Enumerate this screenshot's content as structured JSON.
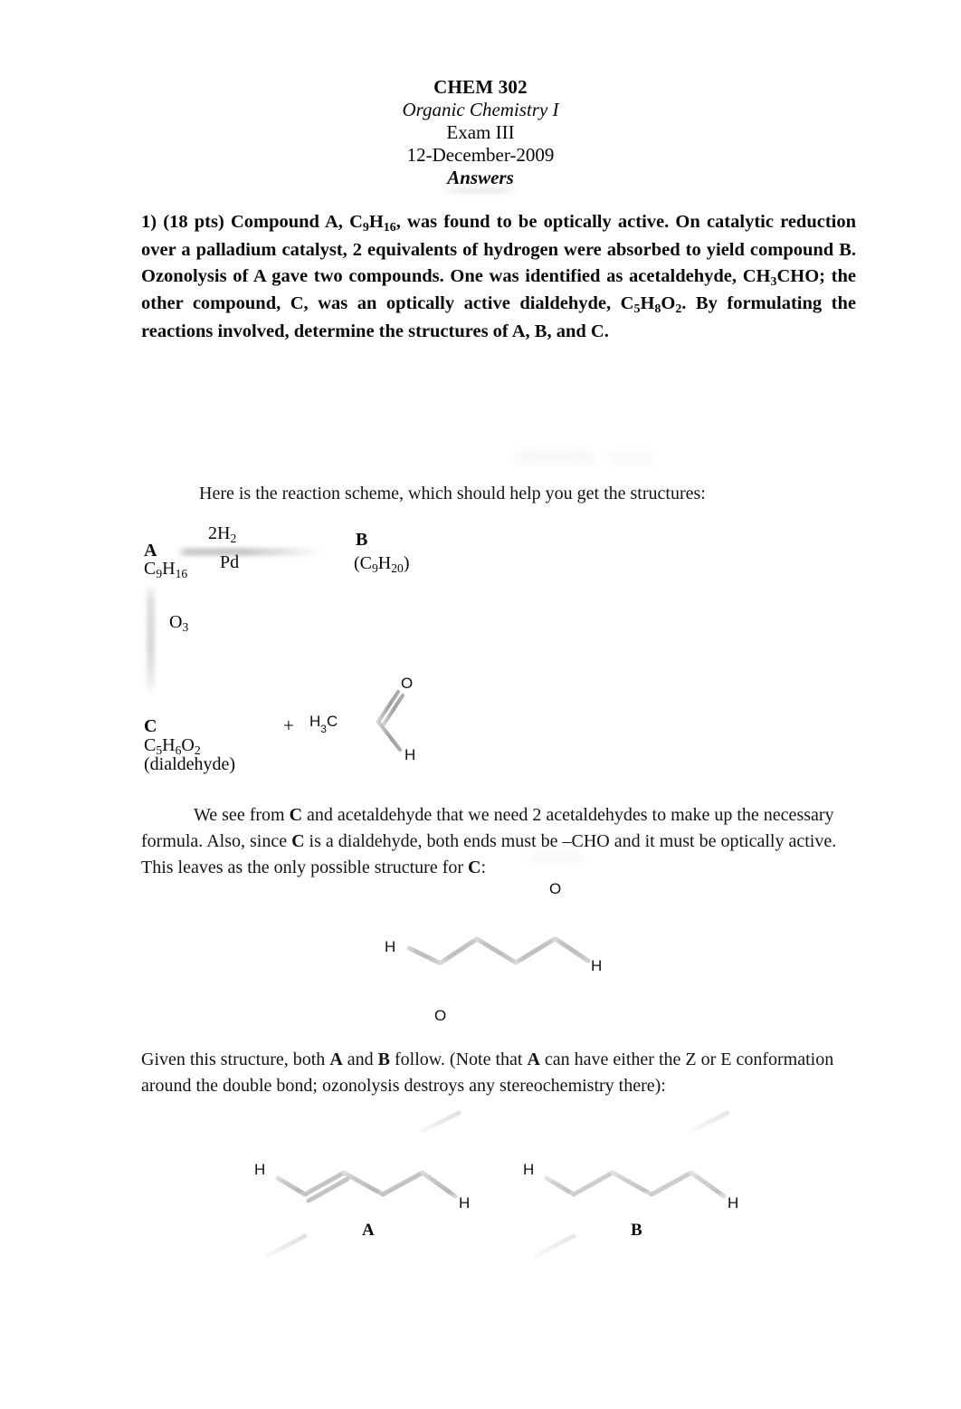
{
  "document": {
    "header": {
      "course": "CHEM 302",
      "subtitle": "Organic Chemistry I",
      "exam": "Exam III",
      "date": "12-December-2009",
      "answers": "Answers"
    },
    "problem": {
      "number": "1)",
      "points": "(18 pts)",
      "text_part_1": "1) (18 pts) Compound A, C",
      "full_text": "1) (18 pts) Compound A, C9H16, was found to be optically active. On catalytic reduction over a palladium catalyst, 2 equivalents of hydrogen were absorbed to yield compound B. Ozonolysis of A gave two compounds. One was identified as acetaldehyde, CH3CHO; the other compound, C, was an optically active dialdehyde, C5H8O2. By formulating the reactions involved, determine the structures of A, B, and C."
    },
    "intro_line": "Here is the reaction scheme, which should help you get the structures:",
    "scheme": {
      "compound_a_label": "A",
      "compound_a_formula_c": "C",
      "compound_a_formula_sub1": "9",
      "compound_a_formula_h": "H",
      "compound_a_formula_sub2": "16",
      "reagent_top": "2H",
      "reagent_top_sub": "2",
      "reagent_bottom": "Pd",
      "compound_b_label": "B",
      "compound_b_formula": "(C",
      "compound_b_sub1": "9",
      "compound_b_h": "H",
      "compound_b_sub2": "20",
      "compound_b_close": ")",
      "ozone_reagent": "O",
      "ozone_sub": "3",
      "compound_c_label": "C",
      "compound_c_formula_c": "C",
      "compound_c_sub1": "5",
      "compound_c_h": "H",
      "compound_c_sub2": "6",
      "compound_c_o": "O",
      "compound_c_sub3": "2",
      "compound_c_note": "(dialdehyde)",
      "plus_sign": "+",
      "acetaldehyde_methyl": "H",
      "acetaldehyde_methyl_sub": "3",
      "acetaldehyde_methyl_c": "C",
      "acetaldehyde_o": "O",
      "acetaldehyde_h": "H"
    },
    "paragraph_c": {
      "line1_a": "We see from ",
      "line1_b": "C",
      "line1_c": " and acetaldehyde that we need 2 acetaldehydes to make up the necessary formula. Also, since ",
      "line1_d": "C",
      "line1_e": " is a dialdehyde, both ends must be –CHO and it must be optically active. This leaves as the only possible structure for ",
      "line1_f": "C",
      "line1_g": ":"
    },
    "structure_c": {
      "label_h_left": "H",
      "label_o_bottom": "O",
      "label_o_top": "O",
      "label_h_right": "H"
    },
    "paragraph_ab": {
      "part1": "Given this structure, both ",
      "bold_a": "A",
      "part2": " and ",
      "bold_b": "B",
      "part3": " follow. (Note that ",
      "bold_a2": "A",
      "part4": " can have either the Z or E conformation around the double bond; ozonolysis destroys any stereochemistry there):"
    },
    "structure_a": {
      "label": "A",
      "label_h_left": "H",
      "label_h_right": "H"
    },
    "structure_b": {
      "label": "B",
      "label_h_left": "H",
      "label_h_right": "H"
    }
  },
  "colors": {
    "text": "#0a0a0a",
    "background": "#ffffff",
    "faded_arrow": "#6e6e6e",
    "bond_line": "#b9b9b9"
  }
}
